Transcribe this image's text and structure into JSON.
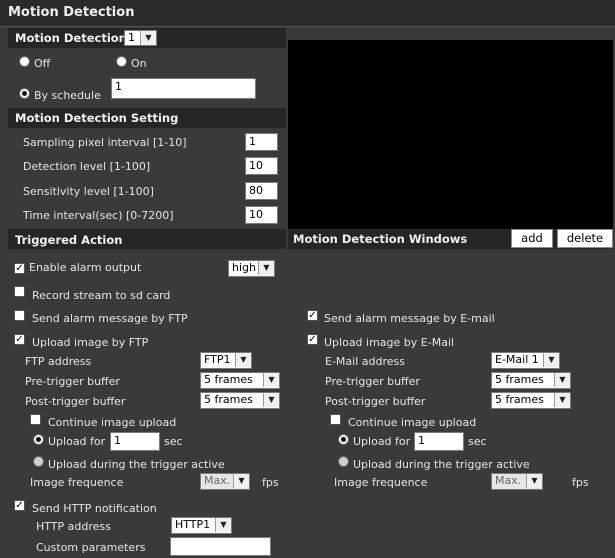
{
  "page_title": "Motion Detection",
  "motion": {
    "header_label": "Motion Detection",
    "window_select": "1",
    "off_label": "Off",
    "on_label": "On",
    "schedule_label": "By schedule",
    "schedule_value": "1",
    "selected_mode": "by-schedule"
  },
  "settings": {
    "header": "Motion Detection Setting",
    "rows": [
      {
        "label": "Sampling pixel interval [1-10]",
        "value": "1"
      },
      {
        "label": "Detection level [1-100]",
        "value": "10"
      },
      {
        "label": "Sensitivity level [1-100]",
        "value": "80"
      },
      {
        "label": "Time interval(sec) [0-7200]",
        "value": "10"
      }
    ]
  },
  "windows": {
    "header": "Motion Detection Windows",
    "add_label": "add",
    "delete_label": "delete"
  },
  "triggered": {
    "header": "Triggered Action",
    "alarm_output": {
      "label": "Enable alarm output",
      "checked": true,
      "level": "high"
    },
    "record_sd": {
      "label": "Record stream to sd card",
      "checked": false
    },
    "ftp_message": {
      "label": "Send alarm message by FTP",
      "checked": false
    },
    "email_message": {
      "label": "Send alarm message by E-mail",
      "checked": true
    },
    "ftp_upload": {
      "label": "Upload image by FTP",
      "checked": true,
      "address_label": "FTP address",
      "address_value": "FTP1",
      "pre_label": "Pre-trigger buffer",
      "pre_value": "5 frames",
      "post_label": "Post-trigger buffer",
      "post_value": "5 frames",
      "continue_label": "Continue image upload",
      "continue_checked": false,
      "upload_for_label": "Upload for",
      "upload_for_value": "1",
      "sec_label": "sec",
      "during_label": "Upload during the trigger active",
      "freq_label": "Image frequence",
      "freq_value": "Max.",
      "fps_label": "fps"
    },
    "email_upload": {
      "label": "Upload image by E-Mail",
      "checked": true,
      "address_label": "E-Mail address",
      "address_value": "E-Mail 1",
      "pre_label": "Pre-trigger buffer",
      "pre_value": "5 frames",
      "post_label": "Post-trigger buffer",
      "post_value": "5 frames",
      "continue_label": "Continue image upload",
      "continue_checked": false,
      "upload_for_label": "Upload for",
      "upload_for_value": "1",
      "sec_label": "sec",
      "during_label": "Upload during the trigger active",
      "freq_label": "Image frequence",
      "freq_value": "Max.",
      "fps_label": "fps"
    },
    "http": {
      "label": "Send HTTP notification",
      "checked": true,
      "address_label": "HTTP address",
      "address_value": "HTTP1",
      "custom_label": "Custom parameters",
      "custom_value": ""
    }
  }
}
